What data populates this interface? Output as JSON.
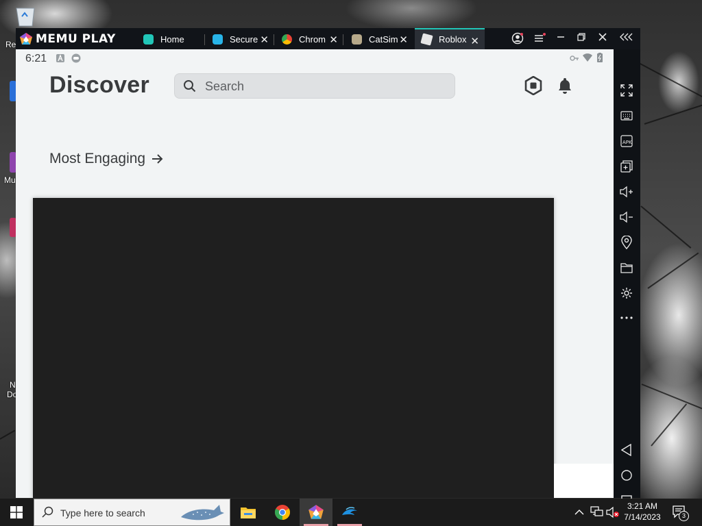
{
  "desktop": {
    "icons": [
      "Re",
      "Mu",
      "N",
      "Do"
    ]
  },
  "emulator": {
    "brand": "MEMU PLAY",
    "tabs": [
      {
        "label": "Home",
        "icon": "memu-home-icon",
        "closable": false
      },
      {
        "label": "Secure",
        "icon": "secure-vpn-icon",
        "closable": true
      },
      {
        "label": "Chrom",
        "icon": "chrome-icon",
        "closable": true
      },
      {
        "label": "CatSim",
        "icon": "catsim-icon",
        "closable": true
      },
      {
        "label": "Roblox",
        "icon": "roblox-icon",
        "closable": true,
        "active": true
      }
    ],
    "window_controls": [
      "account-icon",
      "menu-icon",
      "minimize-icon",
      "restore-icon",
      "close-icon",
      "collapse-sidebar-icon"
    ],
    "sidebar_tools": [
      "fullscreen-icon",
      "keyboard-icon",
      "apk-install-icon",
      "multi-instance-icon",
      "volume-up-icon",
      "volume-down-icon",
      "location-icon",
      "shared-folder-icon",
      "settings-icon",
      "more-icon",
      "back-icon",
      "home-icon",
      "recents-icon"
    ]
  },
  "android": {
    "status": {
      "time": "6:21"
    },
    "header": {
      "title": "Discover",
      "search_placeholder": "Search"
    },
    "section": {
      "title": "Most Engaging",
      "arrow": "→"
    }
  },
  "taskbar": {
    "search_placeholder": "Type here to search",
    "apps": [
      "file-explorer-icon",
      "chrome-icon",
      "memu-icon",
      "edge-dolphin-icon"
    ],
    "clock": {
      "time": "3:21 AM",
      "date": "7/14/2023"
    },
    "notifications": "3"
  },
  "colors": {
    "accent_tab": "#21c6b8",
    "text_dark": "#393b3d",
    "tile_dark": "#1f1f1f"
  }
}
